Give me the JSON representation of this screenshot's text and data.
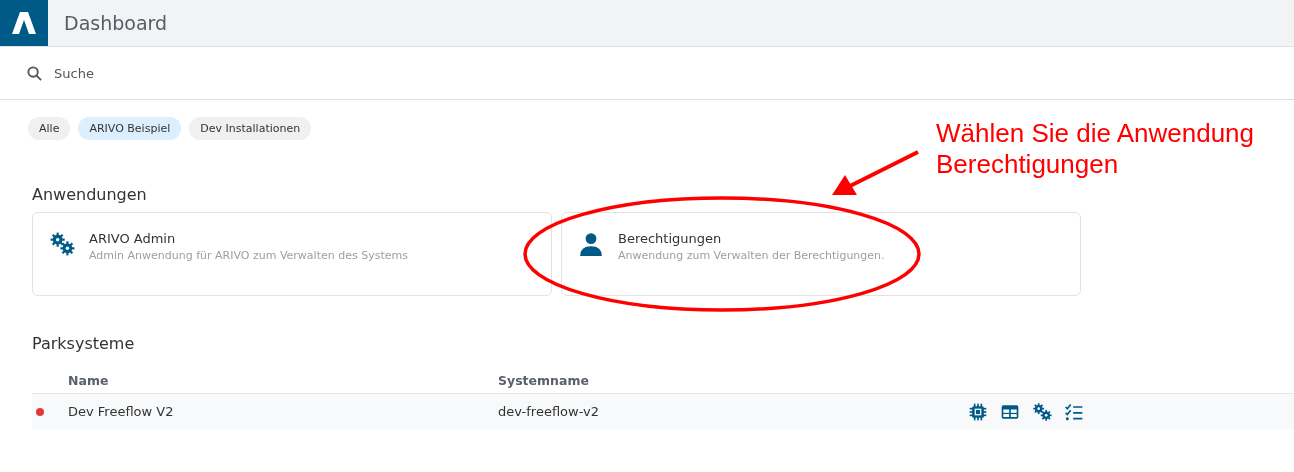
{
  "header": {
    "title": "Dashboard"
  },
  "search": {
    "placeholder": "Suche"
  },
  "filters": [
    {
      "label": "Alle",
      "selected": false
    },
    {
      "label": "ARIVO Beispiel",
      "selected": true
    },
    {
      "label": "Dev Installationen",
      "selected": false
    }
  ],
  "applications": {
    "heading": "Anwendungen",
    "items": [
      {
        "title": "ARIVO Admin",
        "description": "Admin Anwendung für ARIVO zum Verwalten des Systems"
      },
      {
        "title": "Berechtigungen",
        "description": "Anwendung zum Verwalten der Berechtigungen."
      }
    ]
  },
  "parking_systems": {
    "heading": "Parksysteme",
    "columns": [
      "Name",
      "Systemname"
    ],
    "rows": [
      {
        "color": "#e53935",
        "name": "Dev Freeflow V2",
        "system_name": "dev-freeflow-v2"
      }
    ]
  },
  "annotation": {
    "lines": [
      "Wählen Sie die Anwendung",
      "Berechtigungen"
    ]
  }
}
